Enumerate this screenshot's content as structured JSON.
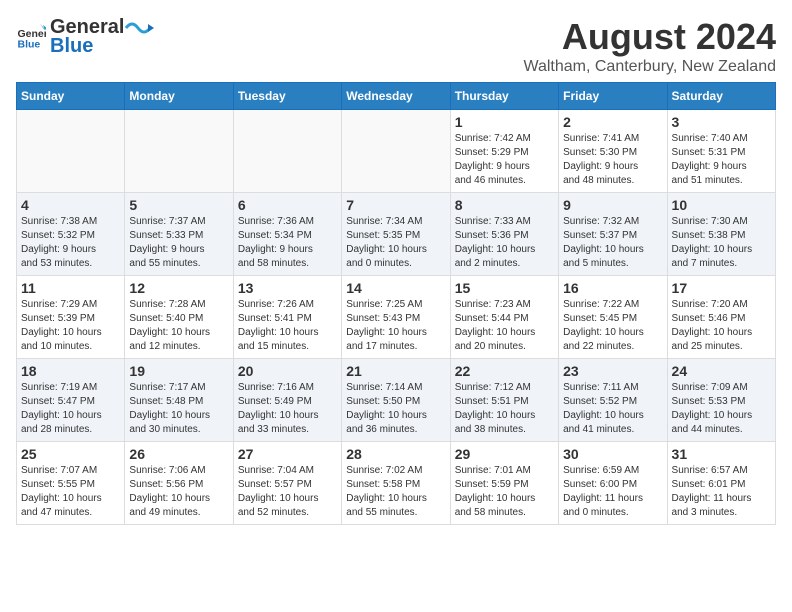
{
  "header": {
    "logo_general": "General",
    "logo_blue": "Blue",
    "title": "August 2024",
    "subtitle": "Waltham, Canterbury, New Zealand"
  },
  "calendar": {
    "days_of_week": [
      "Sunday",
      "Monday",
      "Tuesday",
      "Wednesday",
      "Thursday",
      "Friday",
      "Saturday"
    ],
    "weeks": [
      [
        {
          "day": "",
          "info": ""
        },
        {
          "day": "",
          "info": ""
        },
        {
          "day": "",
          "info": ""
        },
        {
          "day": "",
          "info": ""
        },
        {
          "day": "1",
          "info": "Sunrise: 7:42 AM\nSunset: 5:29 PM\nDaylight: 9 hours\nand 46 minutes."
        },
        {
          "day": "2",
          "info": "Sunrise: 7:41 AM\nSunset: 5:30 PM\nDaylight: 9 hours\nand 48 minutes."
        },
        {
          "day": "3",
          "info": "Sunrise: 7:40 AM\nSunset: 5:31 PM\nDaylight: 9 hours\nand 51 minutes."
        }
      ],
      [
        {
          "day": "4",
          "info": "Sunrise: 7:38 AM\nSunset: 5:32 PM\nDaylight: 9 hours\nand 53 minutes."
        },
        {
          "day": "5",
          "info": "Sunrise: 7:37 AM\nSunset: 5:33 PM\nDaylight: 9 hours\nand 55 minutes."
        },
        {
          "day": "6",
          "info": "Sunrise: 7:36 AM\nSunset: 5:34 PM\nDaylight: 9 hours\nand 58 minutes."
        },
        {
          "day": "7",
          "info": "Sunrise: 7:34 AM\nSunset: 5:35 PM\nDaylight: 10 hours\nand 0 minutes."
        },
        {
          "day": "8",
          "info": "Sunrise: 7:33 AM\nSunset: 5:36 PM\nDaylight: 10 hours\nand 2 minutes."
        },
        {
          "day": "9",
          "info": "Sunrise: 7:32 AM\nSunset: 5:37 PM\nDaylight: 10 hours\nand 5 minutes."
        },
        {
          "day": "10",
          "info": "Sunrise: 7:30 AM\nSunset: 5:38 PM\nDaylight: 10 hours\nand 7 minutes."
        }
      ],
      [
        {
          "day": "11",
          "info": "Sunrise: 7:29 AM\nSunset: 5:39 PM\nDaylight: 10 hours\nand 10 minutes."
        },
        {
          "day": "12",
          "info": "Sunrise: 7:28 AM\nSunset: 5:40 PM\nDaylight: 10 hours\nand 12 minutes."
        },
        {
          "day": "13",
          "info": "Sunrise: 7:26 AM\nSunset: 5:41 PM\nDaylight: 10 hours\nand 15 minutes."
        },
        {
          "day": "14",
          "info": "Sunrise: 7:25 AM\nSunset: 5:43 PM\nDaylight: 10 hours\nand 17 minutes."
        },
        {
          "day": "15",
          "info": "Sunrise: 7:23 AM\nSunset: 5:44 PM\nDaylight: 10 hours\nand 20 minutes."
        },
        {
          "day": "16",
          "info": "Sunrise: 7:22 AM\nSunset: 5:45 PM\nDaylight: 10 hours\nand 22 minutes."
        },
        {
          "day": "17",
          "info": "Sunrise: 7:20 AM\nSunset: 5:46 PM\nDaylight: 10 hours\nand 25 minutes."
        }
      ],
      [
        {
          "day": "18",
          "info": "Sunrise: 7:19 AM\nSunset: 5:47 PM\nDaylight: 10 hours\nand 28 minutes."
        },
        {
          "day": "19",
          "info": "Sunrise: 7:17 AM\nSunset: 5:48 PM\nDaylight: 10 hours\nand 30 minutes."
        },
        {
          "day": "20",
          "info": "Sunrise: 7:16 AM\nSunset: 5:49 PM\nDaylight: 10 hours\nand 33 minutes."
        },
        {
          "day": "21",
          "info": "Sunrise: 7:14 AM\nSunset: 5:50 PM\nDaylight: 10 hours\nand 36 minutes."
        },
        {
          "day": "22",
          "info": "Sunrise: 7:12 AM\nSunset: 5:51 PM\nDaylight: 10 hours\nand 38 minutes."
        },
        {
          "day": "23",
          "info": "Sunrise: 7:11 AM\nSunset: 5:52 PM\nDaylight: 10 hours\nand 41 minutes."
        },
        {
          "day": "24",
          "info": "Sunrise: 7:09 AM\nSunset: 5:53 PM\nDaylight: 10 hours\nand 44 minutes."
        }
      ],
      [
        {
          "day": "25",
          "info": "Sunrise: 7:07 AM\nSunset: 5:55 PM\nDaylight: 10 hours\nand 47 minutes."
        },
        {
          "day": "26",
          "info": "Sunrise: 7:06 AM\nSunset: 5:56 PM\nDaylight: 10 hours\nand 49 minutes."
        },
        {
          "day": "27",
          "info": "Sunrise: 7:04 AM\nSunset: 5:57 PM\nDaylight: 10 hours\nand 52 minutes."
        },
        {
          "day": "28",
          "info": "Sunrise: 7:02 AM\nSunset: 5:58 PM\nDaylight: 10 hours\nand 55 minutes."
        },
        {
          "day": "29",
          "info": "Sunrise: 7:01 AM\nSunset: 5:59 PM\nDaylight: 10 hours\nand 58 minutes."
        },
        {
          "day": "30",
          "info": "Sunrise: 6:59 AM\nSunset: 6:00 PM\nDaylight: 11 hours\nand 0 minutes."
        },
        {
          "day": "31",
          "info": "Sunrise: 6:57 AM\nSunset: 6:01 PM\nDaylight: 11 hours\nand 3 minutes."
        }
      ]
    ]
  }
}
